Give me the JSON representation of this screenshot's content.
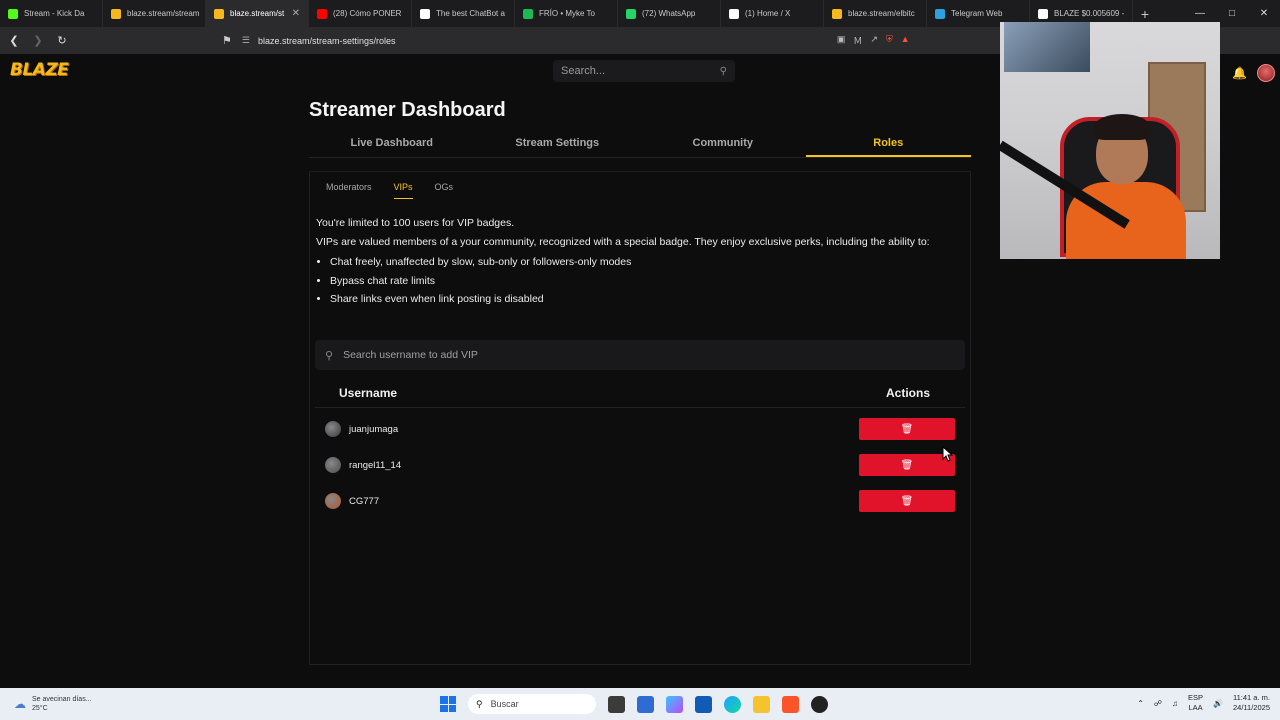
{
  "browser": {
    "tabs": [
      {
        "label": "Stream - Kick Da",
        "color": "#53fc18",
        "active": false
      },
      {
        "label": "blaze.stream/stream",
        "color": "#f5b91e",
        "active": false
      },
      {
        "label": "blaze.stream/st",
        "color": "#f5b91e",
        "active": true
      },
      {
        "label": "(28) Cómo PONER",
        "color": "#ff0000",
        "active": false
      },
      {
        "label": "The best ChatBot a",
        "color": "#ffffff",
        "active": false
      },
      {
        "label": "FRÍO • Myke To",
        "color": "#1db954",
        "active": false
      },
      {
        "label": "(72) WhatsApp",
        "color": "#25d366",
        "active": false
      },
      {
        "label": "(1) Home / X",
        "color": "#ffffff",
        "active": false
      },
      {
        "label": "blaze.stream/elbitc",
        "color": "#f5b91e",
        "active": false
      },
      {
        "label": "Telegram Web",
        "color": "#2aa3e0",
        "active": false
      },
      {
        "label": "BLAZE $0.005609 -",
        "color": "#ffffff",
        "active": false
      }
    ],
    "url": "blaze.stream/stream-settings/roles"
  },
  "site": {
    "logo": "BLAZE",
    "search_placeholder": "Search..."
  },
  "dashboard": {
    "title": "Streamer Dashboard",
    "tabs": [
      "Live Dashboard",
      "Stream Settings",
      "Community",
      "Roles"
    ],
    "active_tab": "Roles",
    "subtabs": [
      "Moderators",
      "VIPs",
      "OGs"
    ],
    "active_subtab": "VIPs",
    "limit_text": "You're limited to 100 users for VIP badges.",
    "description": "VIPs are valued members of a your community, recognized with a special badge. They enjoy exclusive perks, including the ability to:",
    "perks": [
      "Chat freely, unaffected by slow, sub-only or followers-only modes",
      "Bypass chat rate limits",
      "Share links even when link posting is disabled"
    ],
    "vip_search_placeholder": "Search username to add VIP",
    "table": {
      "headers": [
        "Username",
        "Actions"
      ],
      "rows": [
        {
          "username": "juanjumaga",
          "avatar_color": "#3a3a40"
        },
        {
          "username": "rangel11_14",
          "avatar_color": "#4a4a52"
        },
        {
          "username": "CG777",
          "avatar_color": "#b4542c"
        }
      ],
      "delete_icon": "trash-icon"
    }
  },
  "taskbar": {
    "weather_line1": "Se avecinan días...",
    "weather_line2": "25°C",
    "search_label": "Buscar",
    "lang_line1": "ESP",
    "lang_line2": "LAA",
    "time": "11:41 a. m.",
    "date": "24/11/2025"
  },
  "colors": {
    "accent": "#f5c322",
    "danger": "#e0132a"
  }
}
